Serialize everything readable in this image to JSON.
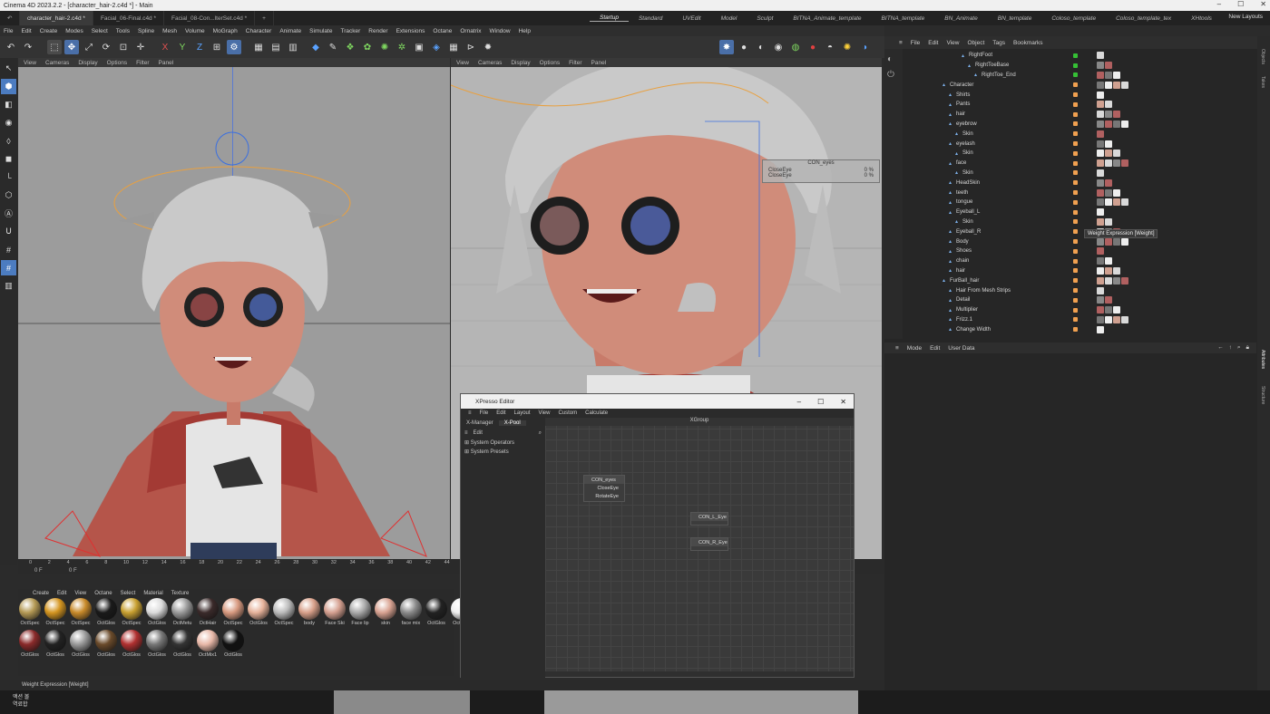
{
  "window": {
    "title": "Cinema 4D 2023.2.2 - [character_hair-2.c4d *] - Main"
  },
  "doc_tabs": [
    "character_hair-2.c4d *",
    "Facial_06-Final.c4d *",
    "Facial_08-Con...lterSet.c4d *"
  ],
  "layouts": [
    "Startup",
    "Standard",
    "UVEdit",
    "Model",
    "Sculpt",
    "BITNA_Animate_template",
    "BITNA_template",
    "BN_Animate",
    "BN_template",
    "Coloso_template",
    "Coloso_template_tex",
    "XHtools"
  ],
  "new_layouts": "New Layouts",
  "menu": [
    "File",
    "Edit",
    "Create",
    "Modes",
    "Select",
    "Tools",
    "Spline",
    "Mesh",
    "Volume",
    "MoGraph",
    "Character",
    "Animate",
    "Simulate",
    "Tracker",
    "Render",
    "Extensions",
    "Octane",
    "Ornatrix",
    "Window",
    "Help"
  ],
  "viewport_menu": [
    "View",
    "Cameras",
    "Display",
    "Options",
    "Filter",
    "Panel"
  ],
  "om_menu": [
    "File",
    "Edit",
    "View",
    "Object",
    "Tags",
    "Bookmarks"
  ],
  "objects": [
    {
      "name": "RightFoot",
      "indent": 3
    },
    {
      "name": "RightToeBase",
      "indent": 4
    },
    {
      "name": "RightToe_End",
      "indent": 5
    },
    {
      "name": "Character",
      "indent": 0
    },
    {
      "name": "Shirts",
      "indent": 1
    },
    {
      "name": "Pants",
      "indent": 1
    },
    {
      "name": "hair",
      "indent": 1
    },
    {
      "name": "eyebrow",
      "indent": 1
    },
    {
      "name": "Skin",
      "indent": 2
    },
    {
      "name": "eyelash",
      "indent": 1
    },
    {
      "name": "Skin",
      "indent": 2
    },
    {
      "name": "face",
      "indent": 1
    },
    {
      "name": "Skin",
      "indent": 2
    },
    {
      "name": "HeadSkin",
      "indent": 1
    },
    {
      "name": "teeth",
      "indent": 1
    },
    {
      "name": "tongue",
      "indent": 1
    },
    {
      "name": "Eyeball_L",
      "indent": 1
    },
    {
      "name": "Skin",
      "indent": 2
    },
    {
      "name": "Eyeball_R",
      "indent": 1
    },
    {
      "name": "Body",
      "indent": 1
    },
    {
      "name": "Shoes",
      "indent": 1
    },
    {
      "name": "chain",
      "indent": 1
    },
    {
      "name": "hair",
      "indent": 1
    },
    {
      "name": "FurBall_hair",
      "indent": 0
    },
    {
      "name": "Hair From Mesh Strips",
      "indent": 1
    },
    {
      "name": "Detail",
      "indent": 1
    },
    {
      "name": "Multiplier",
      "indent": 1
    },
    {
      "name": "Frizz.1",
      "indent": 1
    },
    {
      "name": "Change Width",
      "indent": 1
    }
  ],
  "tooltip": "Weight Expression [Weight]",
  "attr_menu": [
    "Mode",
    "Edit",
    "User Data"
  ],
  "right_side_tabs": [
    "Objects",
    "Takes",
    "Attributes",
    "Structure"
  ],
  "hud": {
    "title": "CON_eyes",
    "rows": [
      {
        "label": "CloseEye",
        "value": "0 %"
      },
      {
        "label": "CloseEye",
        "value": "0 %"
      }
    ]
  },
  "timeline": {
    "ticks": [
      "0",
      "2",
      "4",
      "6",
      "8",
      "10",
      "12",
      "14",
      "16",
      "18",
      "20",
      "22",
      "24",
      "26",
      "28",
      "30",
      "32",
      "34",
      "36",
      "38",
      "40",
      "42",
      "44"
    ],
    "frame": "0 F",
    "frame2": "0 F"
  },
  "mat_menu": [
    "Create",
    "Edit",
    "View",
    "Octane",
    "Select",
    "Material",
    "Texture"
  ],
  "materials_row1": [
    {
      "label": "OctSpec",
      "color": "#b59a55"
    },
    {
      "label": "OctSpec",
      "color": "#d49520"
    },
    {
      "label": "OctSpec",
      "color": "#c88a2a"
    },
    {
      "label": "OctGlos",
      "color": "#1a1a1a"
    },
    {
      "label": "OctSpec",
      "color": "#c8a030"
    },
    {
      "label": "OctGlos",
      "color": "#dcdcdc"
    },
    {
      "label": "OctMetu",
      "color": "#9a9a9a"
    },
    {
      "label": "OctHair",
      "color": "#3a2a2a"
    },
    {
      "label": "OctSpec",
      "color": "#d89a80"
    },
    {
      "label": "OctGlos",
      "color": "#e6b29a"
    },
    {
      "label": "OctSpec",
      "color": "#bbbbbb"
    },
    {
      "label": "body",
      "color": "#d8a08a"
    },
    {
      "label": "Face Ski",
      "color": "#d5a090"
    },
    {
      "label": "Face lip",
      "color": "#aaaaaa"
    },
    {
      "label": "skin",
      "color": "#d9a392"
    },
    {
      "label": "face mix",
      "color": "#8a8a8a"
    },
    {
      "label": "OctGlos",
      "color": "#222222"
    },
    {
      "label": "OctGlos",
      "color": "#eeeeee"
    }
  ],
  "materials_row2": [
    {
      "label": "OctGlos",
      "color": "#8a2a2a"
    },
    {
      "label": "OctGlos",
      "color": "#222222"
    },
    {
      "label": "OctGlos",
      "color": "#999999"
    },
    {
      "label": "OctGlos",
      "color": "#6a4a2a"
    },
    {
      "label": "OctGlos",
      "color": "#b03030"
    },
    {
      "label": "OctGlos",
      "color": "#777777"
    },
    {
      "label": "OctGlos",
      "color": "#333333"
    },
    {
      "label": "OctMix1",
      "color": "#e8b8a8"
    },
    {
      "label": "OctGlos",
      "color": "#111111"
    }
  ],
  "xpresso": {
    "title": "XPresso Editor",
    "menu": [
      "File",
      "Edit",
      "Layout",
      "View",
      "Custom",
      "Calculate"
    ],
    "tabs": [
      "X-Manager",
      "X-Pool"
    ],
    "group": "XGroup",
    "edit": "Edit",
    "tree": [
      "System Operators",
      "System Presets"
    ],
    "nodes": {
      "con_eyes": {
        "title": "CON_eyes",
        "ports": [
          "CloseEye",
          "RotateEye"
        ]
      },
      "con_l": {
        "title": "CON_L_Eye"
      },
      "con_r": {
        "title": "CON_R_Eye"
      }
    }
  },
  "status": "Weight Expression [Weight]",
  "taskbar": {
    "ime1": "액션 볼",
    "ime2": "역료합"
  },
  "colors": {
    "accent": "#4a7cc4",
    "green_tag": "#35c035",
    "orange_vis": "#f0a050"
  }
}
